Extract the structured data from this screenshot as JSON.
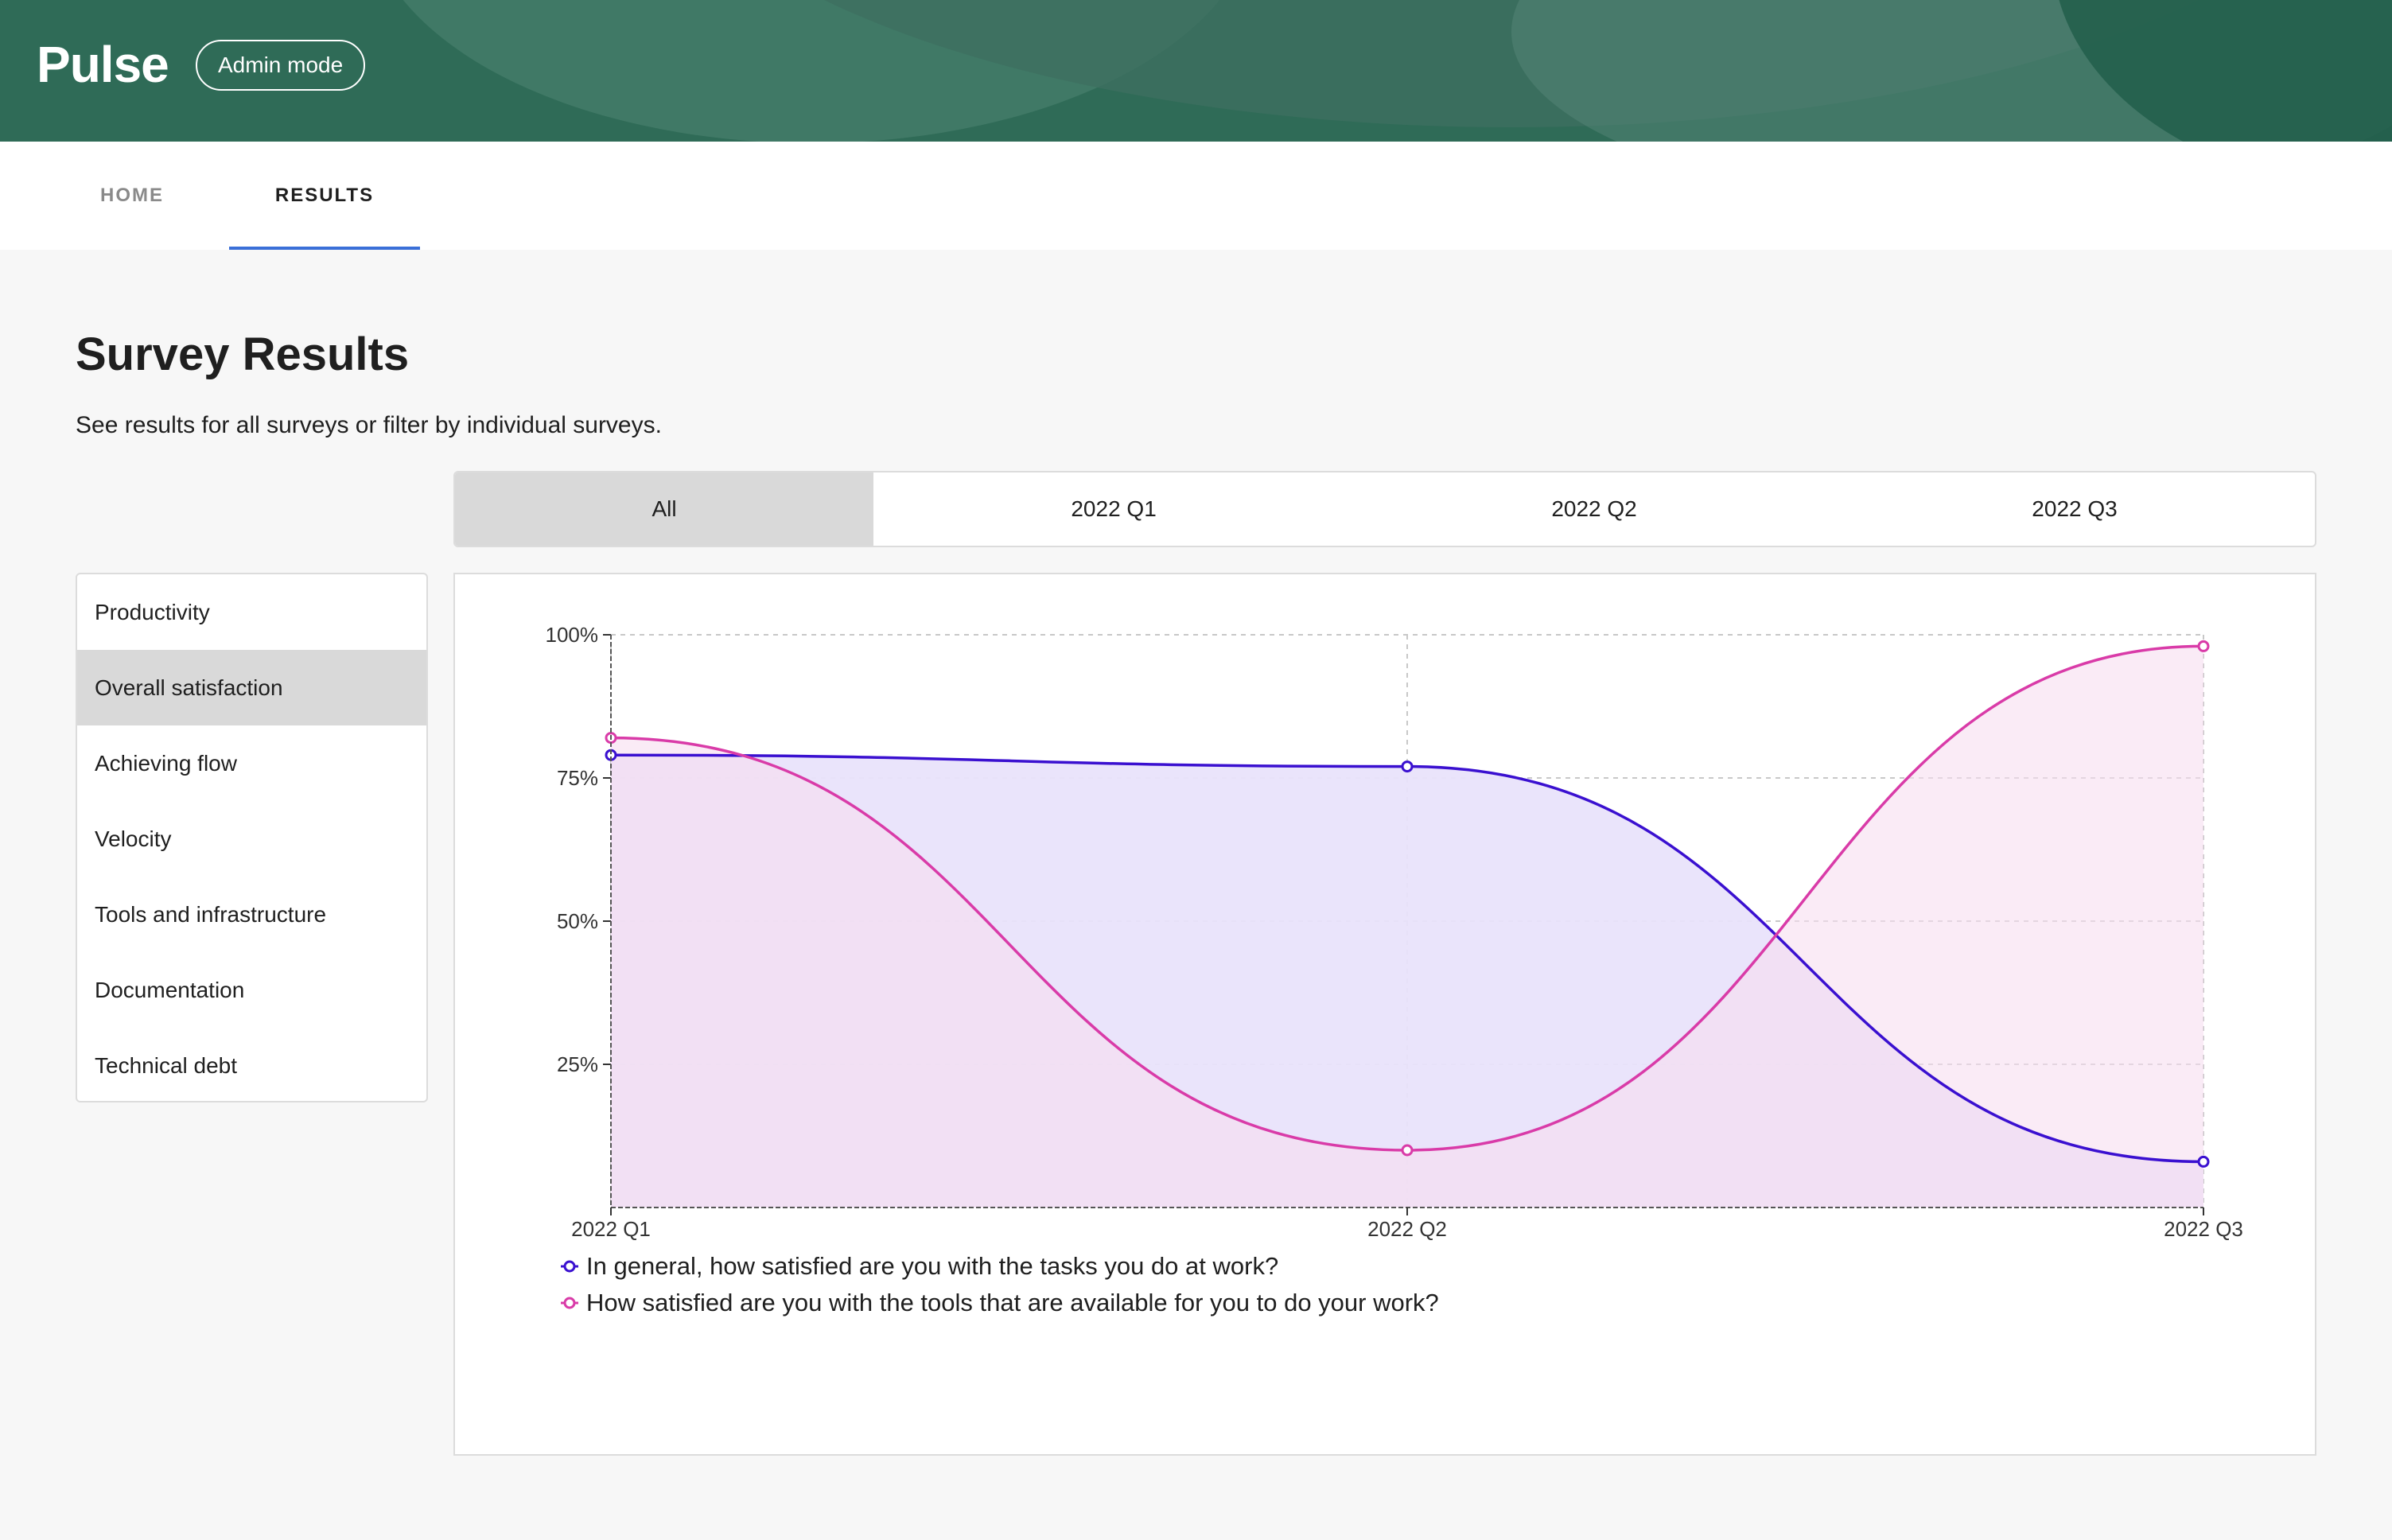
{
  "app": {
    "brand": "Pulse",
    "admin_label": "Admin mode"
  },
  "nav": {
    "tabs": [
      {
        "label": "HOME"
      },
      {
        "label": "RESULTS"
      }
    ]
  },
  "page": {
    "title": "Survey Results",
    "subtitle": "See results for all surveys or filter by individual surveys."
  },
  "filters": {
    "options": [
      "All",
      "2022 Q1",
      "2022 Q2",
      "2022 Q3"
    ],
    "selected": "All"
  },
  "sidebar": {
    "items": [
      {
        "label": "Productivity"
      },
      {
        "label": "Overall satisfaction"
      },
      {
        "label": "Achieving flow"
      },
      {
        "label": "Velocity"
      },
      {
        "label": "Tools and infrastructure"
      },
      {
        "label": "Documentation"
      },
      {
        "label": "Technical debt"
      }
    ],
    "selected": "Overall satisfaction"
  },
  "colors": {
    "header": "#2f6b57",
    "accent": "#3a6fd8",
    "series1": "#3a10d0",
    "series2": "#d93ba8"
  },
  "chart_data": {
    "type": "area",
    "categories": [
      "2022 Q1",
      "2022 Q2",
      "2022 Q3"
    ],
    "yticks": [
      "25%",
      "50%",
      "75%",
      "100%"
    ],
    "ylim": [
      0,
      100
    ],
    "grid": true,
    "legend": "bottom-left",
    "series": [
      {
        "name": "In general, how satisfied are you with the tasks you do at work?",
        "values": [
          79,
          77,
          8
        ],
        "color": "#3a10d0",
        "fill": "#e9e3fb"
      },
      {
        "name": "How satisfied are you with the tools that are available for you to do your work?",
        "values": [
          82,
          10,
          98
        ],
        "color": "#d93ba8",
        "fill": "#f6ddf0"
      }
    ]
  }
}
